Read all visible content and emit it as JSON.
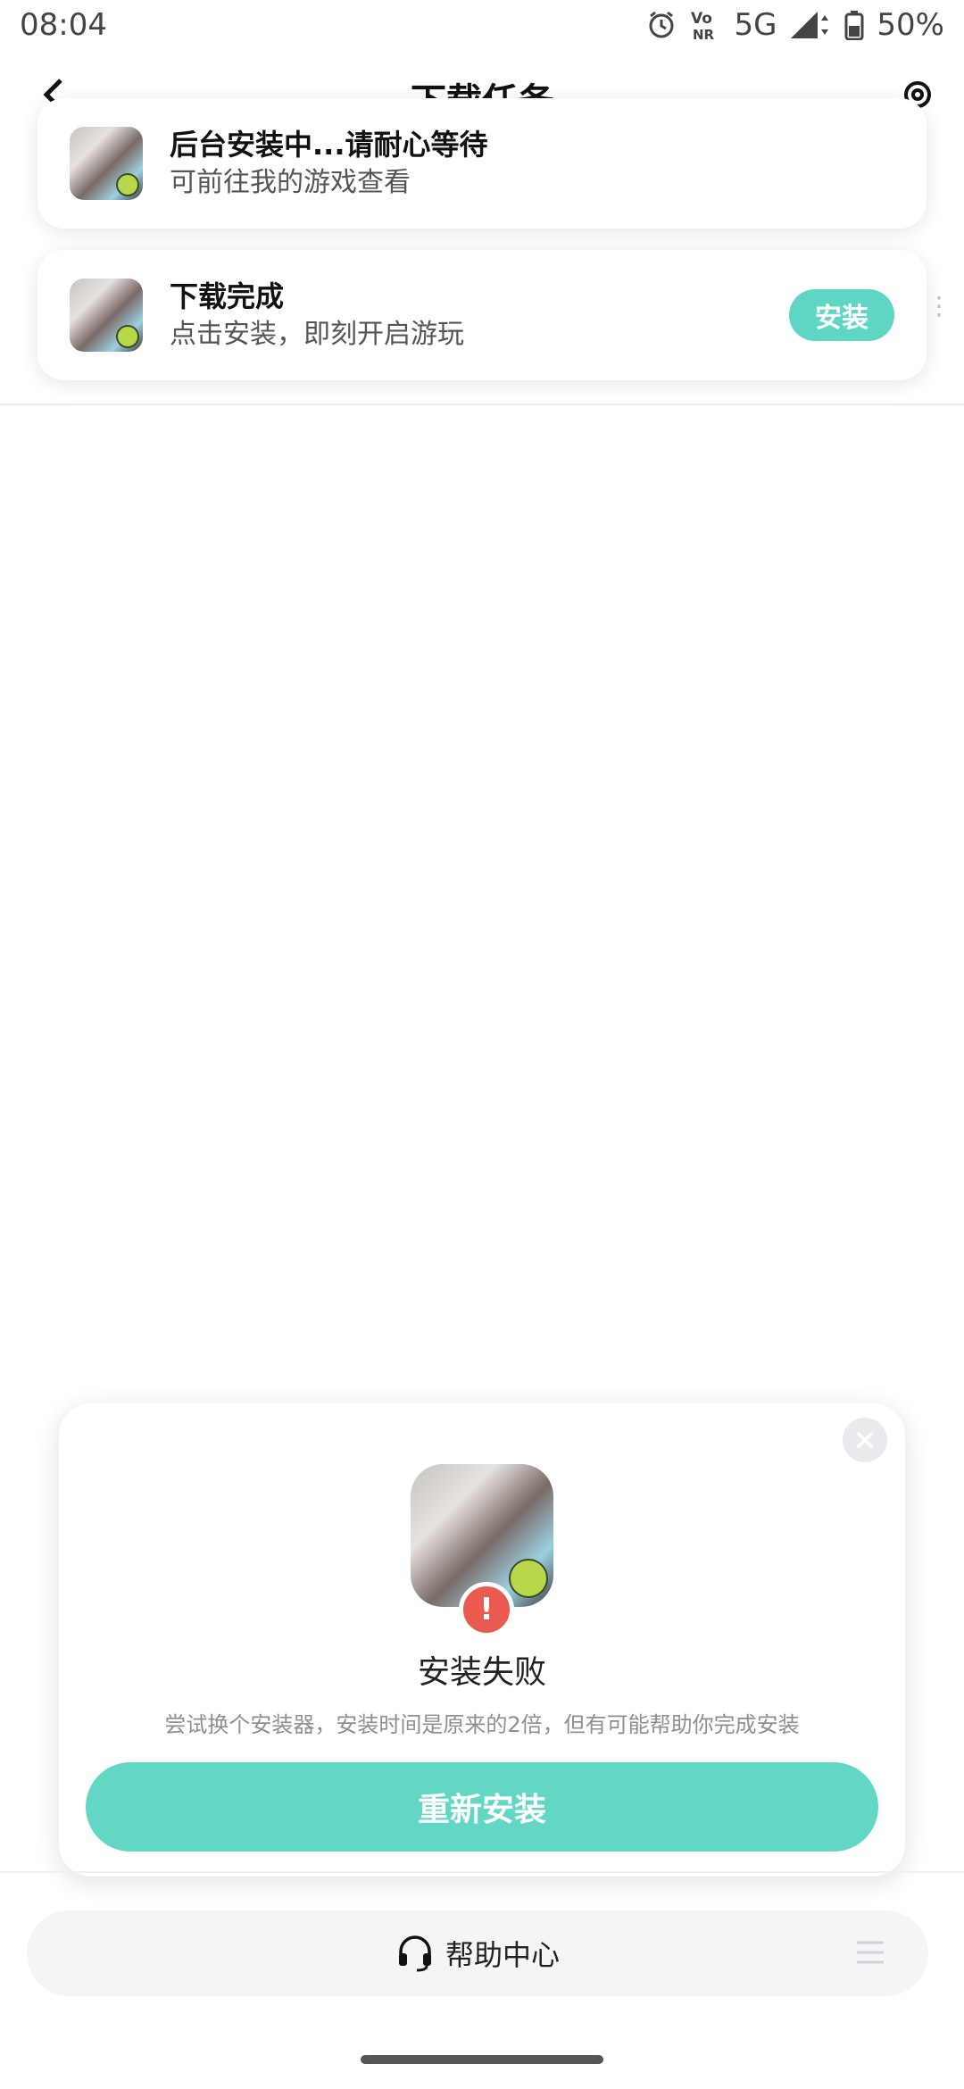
{
  "status_bar": {
    "time": "08:04",
    "network": "5G",
    "battery": "50%",
    "icons": [
      "alarm-icon",
      "vonr-icon",
      "signal-icon",
      "battery-icon"
    ]
  },
  "title_bar": {
    "title": "下载任务"
  },
  "toasts": [
    {
      "title": "后台安装中...请耐心等待",
      "subtitle": "可前往我的游戏查看"
    },
    {
      "title": "下载完成",
      "subtitle": "点击安装，即刻开启游玩",
      "button": "安装"
    }
  ],
  "dialog": {
    "title": "安装失败",
    "description": "尝试换个安装器，安装时间是原来的2倍，但有可能帮助你完成安装",
    "button": "重新安装",
    "error_mark": "!"
  },
  "bottom_bar": {
    "help_label": "帮助中心"
  },
  "colors": {
    "accent": "#5fd6c4",
    "error": "#e85b4e"
  }
}
